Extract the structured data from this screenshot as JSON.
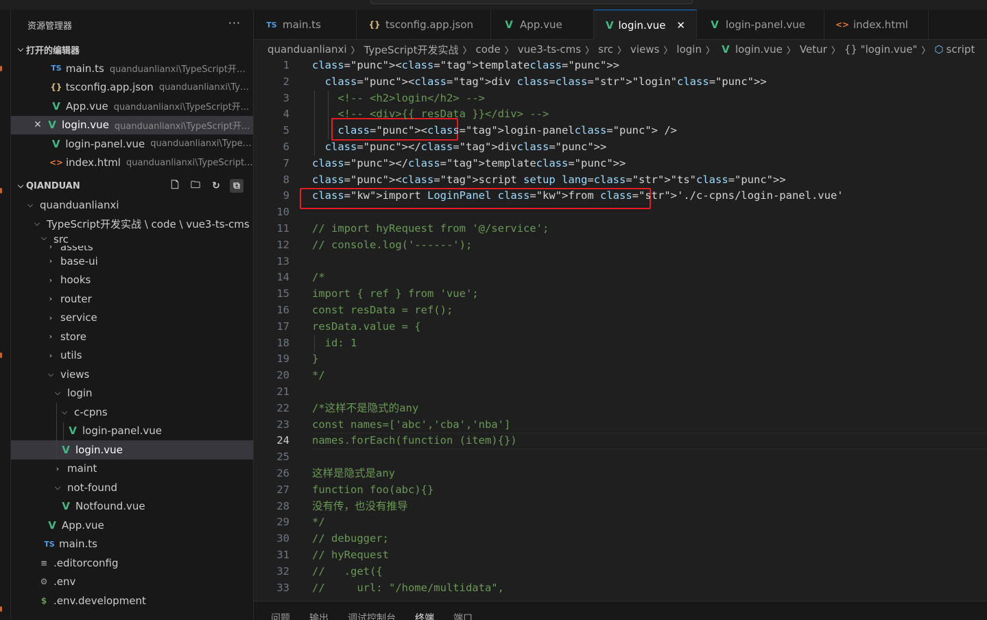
{
  "sidebar": {
    "title": "资源管理器",
    "more": "···",
    "open_editors": {
      "label": "打开的编辑器",
      "items": [
        {
          "icon": "TS",
          "name": "main.ts",
          "path": "quanduanlianxi\\TypeScript开发..."
        },
        {
          "icon": "{}",
          "name": "tsconfig.app.json",
          "path": "quanduanlianxi\\Typ..."
        },
        {
          "icon": "V",
          "name": "App.vue",
          "path": "quanduanlianxi\\TypeScript开..."
        },
        {
          "icon": "V",
          "name": "login.vue",
          "path": "quanduanlianxi\\TypeScript开..."
        },
        {
          "icon": "V",
          "name": "login-panel.vue",
          "path": "quanduanlianxi\\TypeS..."
        },
        {
          "icon": "<>",
          "name": "index.html",
          "path": "quanduanlianxi\\TypeScript..."
        }
      ]
    },
    "workspace": {
      "label": "QIANDUAN",
      "tree": {
        "root": "quanduanlianxi",
        "folder_path": "TypeScript开发实战 \\ code \\ vue3-ts-cms",
        "src": "src",
        "assets": "assets",
        "base_ui": "base-ui",
        "hooks": "hooks",
        "router": "router",
        "service": "service",
        "store": "store",
        "utils": "utils",
        "views": "views",
        "login": "login",
        "c_cpns": "c-cpns",
        "login_panel_vue": "login-panel.vue",
        "login_vue": "login.vue",
        "maint": "maint",
        "not_found": "not-found",
        "notfound_vue": "Notfound.vue",
        "app_vue": "App.vue",
        "main_ts": "main.ts",
        "editorconfig": ".editorconfig",
        "env": ".env",
        "env_dev": ".env.development"
      }
    }
  },
  "tabs": [
    {
      "icon": "TS",
      "label": "main.ts"
    },
    {
      "icon": "{}",
      "label": "tsconfig.app.json"
    },
    {
      "icon": "V",
      "label": "App.vue"
    },
    {
      "icon": "V",
      "label": "login.vue",
      "close": "✕"
    },
    {
      "icon": "V",
      "label": "login-panel.vue"
    },
    {
      "icon": "<>",
      "label": "index.html"
    }
  ],
  "breadcrumb": [
    "quanduanlianxi",
    "TypeScript开发实战",
    "code",
    "vue3-ts-cms",
    "src",
    "views",
    "login",
    "login.vue",
    "Vetur",
    "{} \"login.vue\"",
    "script"
  ],
  "editor": {
    "current_line": 24,
    "lines": [
      "<template>",
      "  <div class=\"login\">",
      "    <!-- <h2>login</h2> -->",
      "    <!-- <div>{{ resData }}</div> -->",
      "    <login-panel />",
      "  </div>",
      "</template>",
      "<script setup lang=\"ts\">",
      "import LoginPanel from './c-cpns/login-panel.vue'",
      "",
      "// import hyRequest from '@/service';",
      "// console.log('------');",
      "",
      "/*",
      "import { ref } from 'vue';",
      "const resData = ref();",
      "resData.value = {",
      "  id: 1",
      "}",
      "*/",
      "",
      "/*这样不是隐式的any",
      "const names=['abc','cba','nba']",
      "names.forEach(function (item){})",
      "",
      "这样是隐式是any",
      "function foo(abc){}",
      "没有传，也没有推导",
      "*/",
      "// debugger;",
      "// hyRequest",
      "//   .get({",
      "//     url: \"/home/multidata\","
    ]
  },
  "panel_tabs": [
    "问题",
    "输出",
    "调试控制台",
    "终端",
    "端口"
  ]
}
